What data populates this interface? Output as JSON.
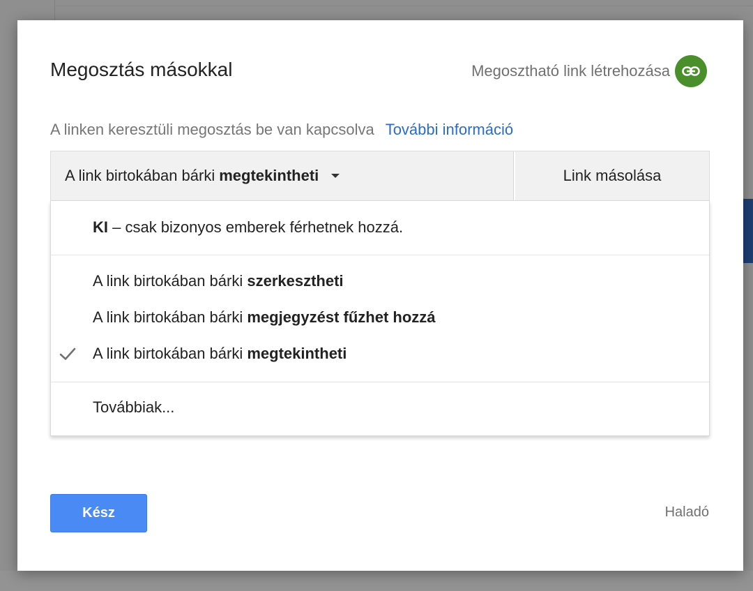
{
  "dialog": {
    "title": "Megosztás másokkal",
    "shareable_link_label": "Megosztható link létrehozása",
    "status_text": "A linken keresztüli megosztás be van kapcsolva",
    "more_info_link": "További információ"
  },
  "access_bar": {
    "prefix": "A link birtokában bárki",
    "selected": "megtekintheti",
    "copy_link": "Link másolása"
  },
  "menu": {
    "off_bold": "KI",
    "off_rest": " – csak bizonyos emberek férhetnek hozzá.",
    "options": [
      {
        "prefix": "A link birtokában bárki ",
        "bold": "szerkesztheti"
      },
      {
        "prefix": "A link birtokában bárki ",
        "bold": "megjegyzést fűzhet hozzá"
      },
      {
        "prefix": "A link birtokában bárki ",
        "bold": "megtekintheti"
      }
    ],
    "more": "Továbbiak..."
  },
  "footer": {
    "done_button": "Kész",
    "advanced_link": "Haladó"
  },
  "colors": {
    "link_green": "#4a8f2c",
    "primary_blue": "#4a8af4",
    "link_blue": "#2a6bd1"
  },
  "icons": {
    "link": "link-icon",
    "check": "check-icon",
    "dropdown": "caret-down-icon"
  }
}
